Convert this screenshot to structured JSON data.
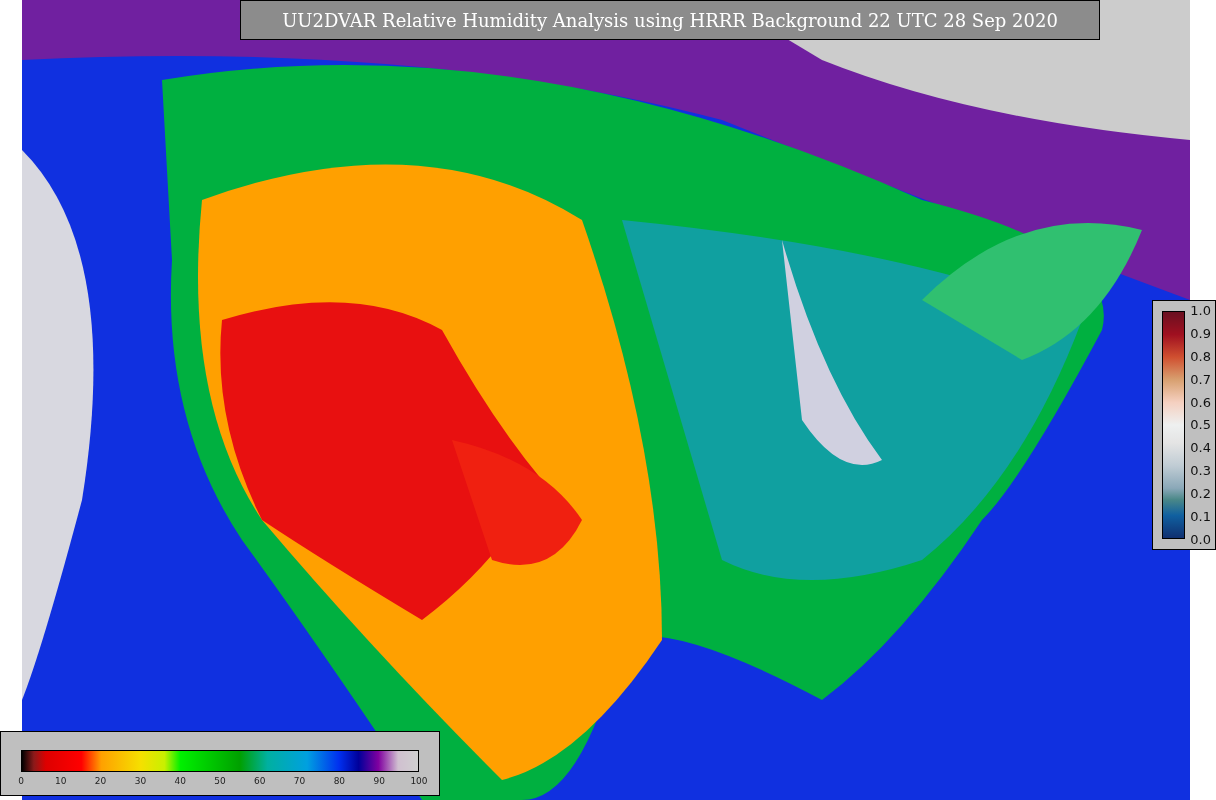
{
  "title": "UU2DVAR Relative Humidity Analysis using HRRR Background 22 UTC 28 Sep 2020",
  "humidity_colorbar": {
    "ticks": [
      "0",
      "10",
      "20",
      "30",
      "40",
      "50",
      "60",
      "70",
      "80",
      "90",
      "100"
    ]
  },
  "error_colorbar": {
    "ticks": [
      "1.0",
      "0.9",
      "0.8",
      "0.7",
      "0.6",
      "0.5",
      "0.4",
      "0.3",
      "0.2",
      "0.1",
      "0.0"
    ]
  }
}
